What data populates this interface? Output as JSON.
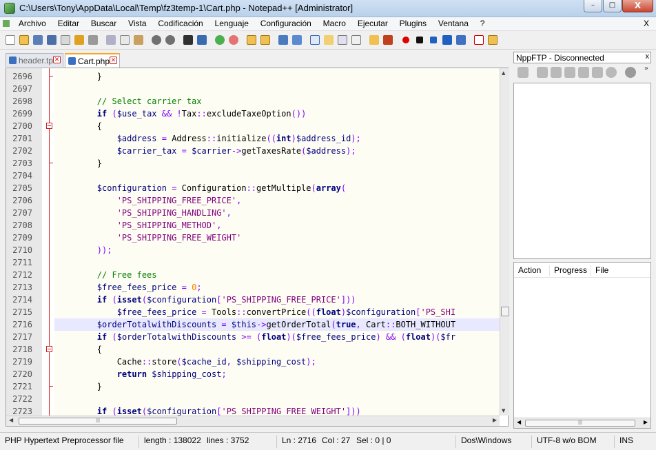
{
  "window": {
    "title": "C:\\Users\\Tony\\AppData\\Local\\Temp\\fz3temp-1\\Cart.php - Notepad++ [Administrator]",
    "minimize": "–",
    "maximize": "□",
    "close": "X"
  },
  "menu": [
    "Archivo",
    "Editar",
    "Buscar",
    "Vista",
    "Codificación",
    "Lenguaje",
    "Configuración",
    "Macro",
    "Ejecutar",
    "Plugins",
    "Ventana",
    "?"
  ],
  "menu_close": "X",
  "tabs": [
    {
      "label": "header.tpl",
      "active": false
    },
    {
      "label": "Cart.php",
      "active": true
    }
  ],
  "editor": {
    "current_line": "2716",
    "lines": [
      {
        "n": "2696",
        "t": "        }"
      },
      {
        "n": "2697",
        "t": ""
      },
      {
        "n": "2698",
        "t": "        // Select carrier tax"
      },
      {
        "n": "2699",
        "t": "        if ($use_tax && !Tax::excludeTaxeOption())"
      },
      {
        "n": "2700",
        "t": "        {"
      },
      {
        "n": "2701",
        "t": "            $address = Address::initialize((int)$address_id);"
      },
      {
        "n": "2702",
        "t": "            $carrier_tax = $carrier->getTaxesRate($address);"
      },
      {
        "n": "2703",
        "t": "        }"
      },
      {
        "n": "2704",
        "t": ""
      },
      {
        "n": "2705",
        "t": "        $configuration = Configuration::getMultiple(array("
      },
      {
        "n": "2706",
        "t": "            'PS_SHIPPING_FREE_PRICE',"
      },
      {
        "n": "2707",
        "t": "            'PS_SHIPPING_HANDLING',"
      },
      {
        "n": "2708",
        "t": "            'PS_SHIPPING_METHOD',"
      },
      {
        "n": "2709",
        "t": "            'PS_SHIPPING_FREE_WEIGHT'"
      },
      {
        "n": "2710",
        "t": "        ));"
      },
      {
        "n": "2711",
        "t": ""
      },
      {
        "n": "2712",
        "t": "        // Free fees"
      },
      {
        "n": "2713",
        "t": "        $free_fees_price = 0;"
      },
      {
        "n": "2714",
        "t": "        if (isset($configuration['PS_SHIPPING_FREE_PRICE']))"
      },
      {
        "n": "2715",
        "t": "            $free_fees_price = Tools::convertPrice((float)$configuration['PS_SHI"
      },
      {
        "n": "2716",
        "t": "        $orderTotalwithDiscounts = $this->getOrderTotal(true, Cart::BOTH_WITHOUT"
      },
      {
        "n": "2717",
        "t": "        if ($orderTotalwithDiscounts >= (float)($free_fees_price) && (float)($fr"
      },
      {
        "n": "2718",
        "t": "        {"
      },
      {
        "n": "2719",
        "t": "            Cache::store($cache_id, $shipping_cost);"
      },
      {
        "n": "2720",
        "t": "            return $shipping_cost;"
      },
      {
        "n": "2721",
        "t": "        }"
      },
      {
        "n": "2722",
        "t": ""
      },
      {
        "n": "2723",
        "t": "        if (isset($configuration['PS_SHIPPING_FREE_WEIGHT']))"
      }
    ]
  },
  "ftp": {
    "title": "NppFTP - Disconnected",
    "close": "x",
    "more": "»",
    "queue_columns": [
      "Action",
      "Progress",
      "File"
    ]
  },
  "status": {
    "filetype": "PHP Hypertext Preprocessor file",
    "length": "length : 138022",
    "lines": "lines : 3752",
    "position": "Ln : 2716",
    "column": "Col : 27",
    "selection": "Sel : 0 | 0",
    "eol": "Dos\\Windows",
    "encoding": "UTF-8 w/o BOM",
    "mode": "INS"
  }
}
